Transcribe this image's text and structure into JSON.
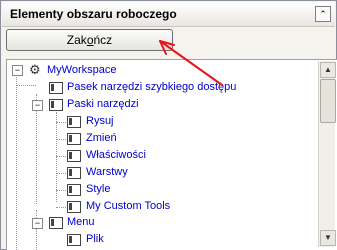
{
  "panel": {
    "title": "Elementy obszaru roboczego",
    "collapse_glyph": "⌃"
  },
  "button": {
    "label_pre": "Zak",
    "label_ul": "o",
    "label_post": "ńcz"
  },
  "tree": {
    "root": "MyWorkspace",
    "quick_access": "Pasek narzędzi szybkiego dostępu",
    "toolbars": "Paski narzędzi",
    "items": [
      "Rysuj",
      "Zmień",
      "Właściwości",
      "Warstwy",
      "Style",
      "My Custom Tools"
    ],
    "menu": "Menu",
    "menu_items": [
      "Plik"
    ]
  },
  "annotation_color": "#e8141c"
}
